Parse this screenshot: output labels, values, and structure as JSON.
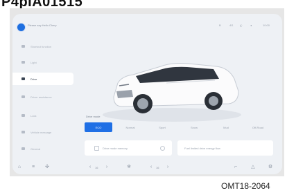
{
  "page": {
    "heading": "P4pIA01515",
    "figure_code": "OMT18-2064"
  },
  "topbar": {
    "prompt": "Please say Hello Chery",
    "status": [
      {
        "icon": "bluetooth-icon",
        "text": "B"
      },
      {
        "icon": "signal-icon",
        "text": "4G"
      },
      {
        "icon": "wifi-icon",
        "text": "((·"
      },
      {
        "icon": "volume-icon",
        "text": "◂"
      },
      {
        "icon": "clock-icon",
        "text": "10:00"
      }
    ]
  },
  "sidebar": {
    "items": [
      {
        "label": "Shortcut function",
        "icon": "shortcut-icon",
        "active": false
      },
      {
        "label": "Light",
        "icon": "light-icon",
        "active": false
      },
      {
        "label": "Drive",
        "icon": "steering-wheel-icon",
        "active": true
      },
      {
        "label": "Driver assistance",
        "icon": "driver-assistance-icon",
        "active": false
      },
      {
        "label": "Lock",
        "icon": "lock-icon",
        "active": false
      },
      {
        "label": "Vehicle message",
        "icon": "vehicle-message-icon",
        "active": false
      },
      {
        "label": "General",
        "icon": "general-icon",
        "active": false
      }
    ]
  },
  "main": {
    "drive_mode_title": "Drive mode",
    "tabs": [
      {
        "label": "ECO",
        "active": true
      },
      {
        "label": "Normal",
        "active": false
      },
      {
        "label": "Sport",
        "active": false
      },
      {
        "label": "Snow",
        "active": false
      },
      {
        "label": "Mud",
        "active": false
      },
      {
        "label": "Off-Road",
        "active": false
      }
    ],
    "card1_text": "Drive mode memory",
    "card2_text": "Fuel limited drive energy flow"
  },
  "bottombar": {
    "temp_left": "16",
    "temp_right": "16"
  },
  "colors": {
    "accent": "#1f6fe5",
    "screen_bg": "#eef1f5",
    "active_item_bg": "#ffffff"
  }
}
